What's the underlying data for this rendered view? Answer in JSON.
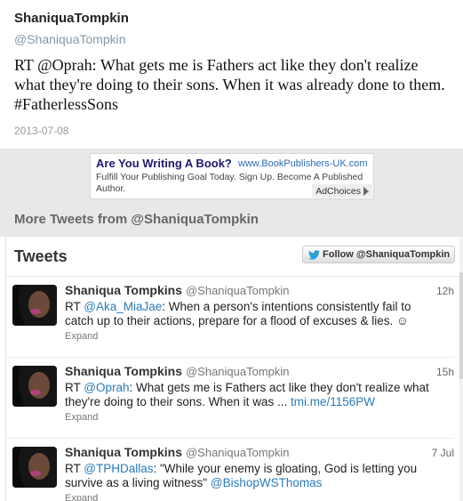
{
  "tweet": {
    "author_name": "ShaniquaTompkin",
    "author_handle": "@ShaniquaTompkin",
    "text": "RT @Oprah: What gets me is Fathers act like they don't realize what they're doing to their sons. When it was already done to them. #FatherlessSons",
    "date": "2013-07-08"
  },
  "ad": {
    "title": "Are You Writing A Book?",
    "url": "www.BookPublishers-UK.com",
    "description": "Fulfill Your Publishing Goal Today. Sign Up. Become A Published Author.",
    "adchoices_label": "AdChoices"
  },
  "more_tweets_heading": "More Tweets from @ShaniquaTompkin",
  "timeline": {
    "title": "Tweets",
    "follow_label": "Follow @ShaniquaTompkin",
    "items": [
      {
        "name": "Shaniqua Tompkins",
        "handle": "@ShaniquaTompkin",
        "time": "12h",
        "prefix": "RT ",
        "mention": "@Aka_MiaJae",
        "text": ": When a person's intentions consistently fail to catch up to their actions, prepare for a flood of excuses & lies. ☺",
        "suffix_link": "",
        "expand": "Expand"
      },
      {
        "name": "Shaniqua Tompkins",
        "handle": "@ShaniquaTompkin",
        "time": "15h",
        "prefix": "RT ",
        "mention": "@Oprah",
        "text": ": What gets me is Fathers act like they don't realize what they're doing to their sons. When it was ... ",
        "suffix_link": "tmi.me/1156PW",
        "expand": "Expand"
      },
      {
        "name": "Shaniqua Tompkins",
        "handle": "@ShaniquaTompkin",
        "time": "7 Jul",
        "prefix": "RT ",
        "mention": "@TPHDallas",
        "text": ": \"While your enemy is gloating, God is letting you survive as a living witness\" ",
        "suffix_link": "@BishopWSThomas",
        "expand": "Expand"
      }
    ]
  },
  "colors": {
    "link": "#2b7bb9",
    "panel_grey": "#e8e8e8",
    "handle_grey": "#8899a6"
  }
}
